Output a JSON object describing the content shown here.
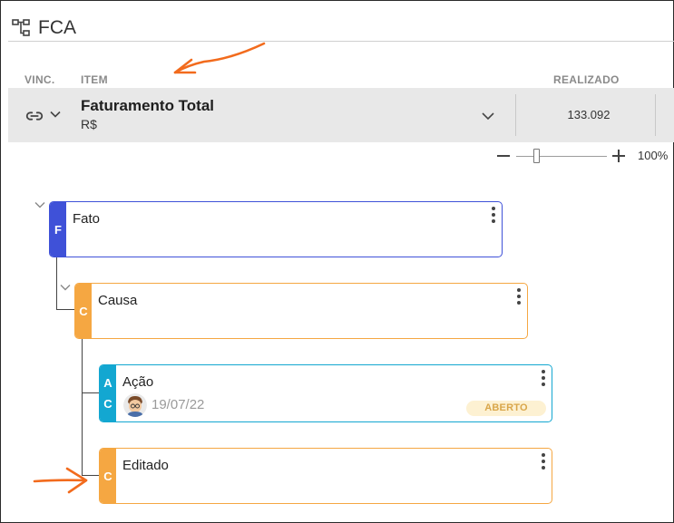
{
  "header": {
    "title": "FCA",
    "icon": "hierarchy-icon"
  },
  "columns": {
    "vinc": "VINC.",
    "item": "ITEM",
    "realizado": "REALIZADO"
  },
  "item_row": {
    "name": "Faturamento Total",
    "unit": "R$",
    "realizado": "133.092",
    "link_icon": "link-icon",
    "background": "#e8e8e8"
  },
  "zoom": {
    "percent": "100%",
    "level": 0.2
  },
  "tree": {
    "fato": {
      "letter": "F",
      "title": "Fato",
      "color": "#3f51d8"
    },
    "causa": {
      "letter": "C",
      "title": "Causa",
      "color": "#f5a742"
    },
    "acao": {
      "letter_a": "A",
      "letter_c": "C",
      "title": "Ação",
      "date": "19/07/22",
      "status": "ABERTO",
      "color": "#13a7d1"
    },
    "editado": {
      "letter": "C",
      "title": "Editado",
      "color": "#f5a742"
    }
  },
  "annotation_color": "#f26b1d"
}
